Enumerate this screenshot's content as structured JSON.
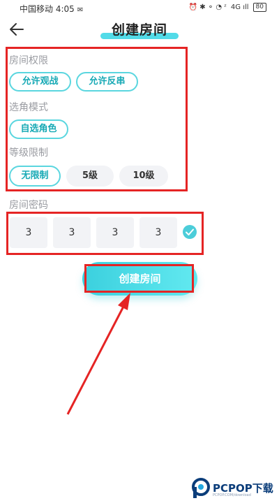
{
  "status_bar": {
    "carrier_time": "中国移动 4:05",
    "chat_glyph": "✉",
    "right_icons": "⏰ ✱ ⚬ ◔ ᶻ",
    "signal": "4G ıll",
    "battery": "80"
  },
  "header": {
    "title": "创建房间"
  },
  "permissions": {
    "label": "房间权限",
    "options": [
      "允许观战",
      "允许反串"
    ]
  },
  "role_mode": {
    "label": "选角模式",
    "options": [
      "自选角色"
    ]
  },
  "level_limit": {
    "label": "等级限制",
    "options": [
      "无限制",
      "5级",
      "10级"
    ]
  },
  "password": {
    "label": "房间密码",
    "digits": [
      "3",
      "3",
      "3",
      "3"
    ]
  },
  "create_button": {
    "label": "创建房间"
  },
  "watermark": {
    "text": "PCPOP下载",
    "sub": "PCPOP.COM/download"
  },
  "colors": {
    "accent": "#52dbe8",
    "annotation_red": "#e52424",
    "pill_text": "#17a9b5"
  }
}
